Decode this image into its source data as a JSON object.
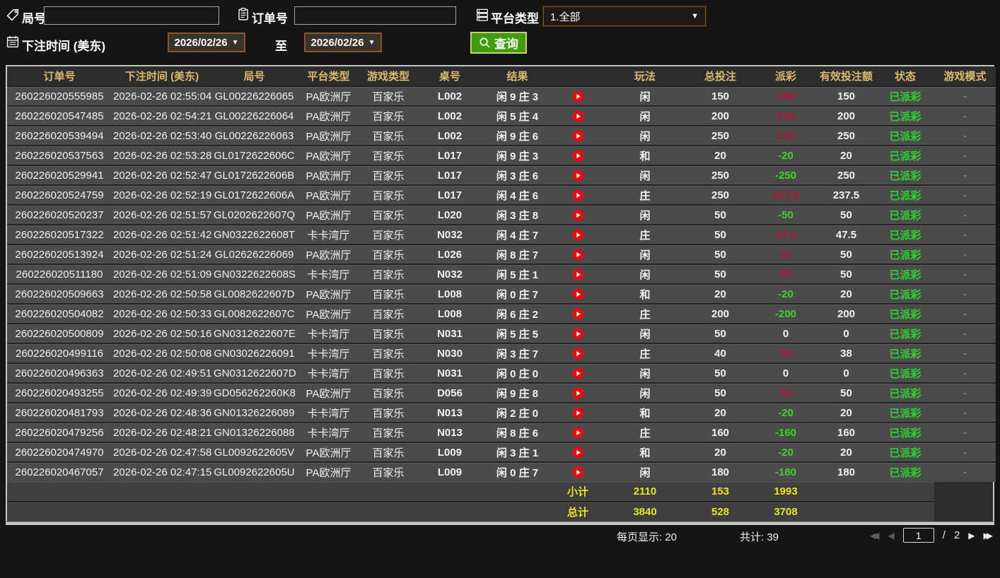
{
  "filters": {
    "round_label": "局号",
    "round_value": "",
    "order_label": "订单号",
    "order_value": "",
    "platform_label": "平台类型",
    "platform_value": "1.全部",
    "caret": "▼",
    "bet_time_label": "下注时间 (美东)",
    "date_from": "2026/02/26",
    "to_label": "至",
    "date_to": "2026/02/26",
    "query_label": "查询"
  },
  "table": {
    "headers": [
      "订单号",
      "下注时间 (美东)",
      "局号",
      "平台类型",
      "游戏类型",
      "桌号",
      "结果",
      "玩法",
      "总投注",
      "派彩",
      "有效投注额",
      "状态",
      "游戏模式"
    ],
    "column_keys": [
      "order_id",
      "bet_time",
      "round_id",
      "platform",
      "game_type",
      "table_id",
      "result",
      "play_type",
      "total_bet",
      "payout",
      "valid_bet",
      "status",
      "game_mode"
    ],
    "play_icon_name": "replay-video-icon",
    "rows": [
      [
        "260226020555985",
        "2026-02-26 02:55:04",
        "GL00226226065",
        "PA欧洲厅",
        "百家乐",
        "L002",
        "闲 9 庄 3",
        "闲",
        "150",
        "150",
        "150",
        "已派彩",
        "-"
      ],
      [
        "260226020547485",
        "2026-02-26 02:54:21",
        "GL00226226064",
        "PA欧洲厅",
        "百家乐",
        "L002",
        "闲 5 庄 4",
        "闲",
        "200",
        "200",
        "200",
        "已派彩",
        "-"
      ],
      [
        "260226020539494",
        "2026-02-26 02:53:40",
        "GL00226226063",
        "PA欧洲厅",
        "百家乐",
        "L002",
        "闲 9 庄 6",
        "闲",
        "250",
        "250",
        "250",
        "已派彩",
        "-"
      ],
      [
        "260226020537563",
        "2026-02-26 02:53:28",
        "GL0172622606C",
        "PA欧洲厅",
        "百家乐",
        "L017",
        "闲 9 庄 3",
        "和",
        "20",
        "-20",
        "20",
        "已派彩",
        "-"
      ],
      [
        "260226020529941",
        "2026-02-26 02:52:47",
        "GL0172622606B",
        "PA欧洲厅",
        "百家乐",
        "L017",
        "闲 3 庄 6",
        "闲",
        "250",
        "-250",
        "250",
        "已派彩",
        "-"
      ],
      [
        "260226020524759",
        "2026-02-26 02:52:19",
        "GL0172622606A",
        "PA欧洲厅",
        "百家乐",
        "L017",
        "闲 4 庄 6",
        "庄",
        "250",
        "237.5",
        "237.5",
        "已派彩",
        "-"
      ],
      [
        "260226020520237",
        "2026-02-26 02:51:57",
        "GL0202622607Q",
        "PA欧洲厅",
        "百家乐",
        "L020",
        "闲 3 庄 8",
        "闲",
        "50",
        "-50",
        "50",
        "已派彩",
        "-"
      ],
      [
        "260226020517322",
        "2026-02-26 02:51:42",
        "GN0322622608T",
        "卡卡湾厅",
        "百家乐",
        "N032",
        "闲 4 庄 7",
        "庄",
        "50",
        "47.5",
        "47.5",
        "已派彩",
        "-"
      ],
      [
        "260226020513924",
        "2026-02-26 02:51:24",
        "GL02626226069",
        "PA欧洲厅",
        "百家乐",
        "L026",
        "闲 8 庄 7",
        "闲",
        "50",
        "50",
        "50",
        "已派彩",
        "-"
      ],
      [
        "260226020511180",
        "2026-02-26 02:51:09",
        "GN0322622608S",
        "卡卡湾厅",
        "百家乐",
        "N032",
        "闲 5 庄 1",
        "闲",
        "50",
        "50",
        "50",
        "已派彩",
        "-"
      ],
      [
        "260226020509663",
        "2026-02-26 02:50:58",
        "GL0082622607D",
        "PA欧洲厅",
        "百家乐",
        "L008",
        "闲 0 庄 7",
        "和",
        "20",
        "-20",
        "20",
        "已派彩",
        "-"
      ],
      [
        "260226020504082",
        "2026-02-26 02:50:33",
        "GL0082622607C",
        "PA欧洲厅",
        "百家乐",
        "L008",
        "闲 6 庄 2",
        "庄",
        "200",
        "-200",
        "200",
        "已派彩",
        "-"
      ],
      [
        "260226020500809",
        "2026-02-26 02:50:16",
        "GN0312622607E",
        "卡卡湾厅",
        "百家乐",
        "N031",
        "闲 5 庄 5",
        "闲",
        "50",
        "0",
        "0",
        "已派彩",
        "-"
      ],
      [
        "260226020499116",
        "2026-02-26 02:50:08",
        "GN03026226091",
        "卡卡湾厅",
        "百家乐",
        "N030",
        "闲 3 庄 7",
        "庄",
        "40",
        "38",
        "38",
        "已派彩",
        "-"
      ],
      [
        "260226020496363",
        "2026-02-26 02:49:51",
        "GN0312622607D",
        "卡卡湾厅",
        "百家乐",
        "N031",
        "闲 0 庄 0",
        "闲",
        "50",
        "0",
        "0",
        "已派彩",
        "-"
      ],
      [
        "260226020493255",
        "2026-02-26 02:49:39",
        "GD056262260K8",
        "PA欧洲厅",
        "百家乐",
        "D056",
        "闲 9 庄 8",
        "闲",
        "50",
        "50",
        "50",
        "已派彩",
        "-"
      ],
      [
        "260226020481793",
        "2026-02-26 02:48:36",
        "GN01326226089",
        "卡卡湾厅",
        "百家乐",
        "N013",
        "闲 2 庄 0",
        "和",
        "20",
        "-20",
        "20",
        "已派彩",
        "-"
      ],
      [
        "260226020479256",
        "2026-02-26 02:48:21",
        "GN01326226088",
        "卡卡湾厅",
        "百家乐",
        "N013",
        "闲 8 庄 6",
        "庄",
        "160",
        "-160",
        "160",
        "已派彩",
        "-"
      ],
      [
        "260226020474970",
        "2026-02-26 02:47:58",
        "GL0092622605V",
        "PA欧洲厅",
        "百家乐",
        "L009",
        "闲 3 庄 1",
        "和",
        "20",
        "-20",
        "20",
        "已派彩",
        "-"
      ],
      [
        "260226020467057",
        "2026-02-26 02:47:15",
        "GL0092622605U",
        "PA欧洲厅",
        "百家乐",
        "L009",
        "闲 0 庄 7",
        "闲",
        "180",
        "-180",
        "180",
        "已派彩",
        "-"
      ]
    ],
    "subtotal": {
      "label": "小计",
      "total_bet": "2110",
      "payout": "153",
      "valid_bet": "1993"
    },
    "total": {
      "label": "总计",
      "total_bet": "3840",
      "payout": "528",
      "valid_bet": "3708"
    }
  },
  "footer": {
    "page_size_label": "每页显示: 20",
    "total_count_label": "共计: 39",
    "pagination": {
      "first_icon": "◀◀",
      "prev_icon": "◀",
      "current_page": "1",
      "separator": "/",
      "total_pages": "2",
      "next_icon": "▶",
      "last_icon": "▶▶"
    }
  },
  "colors": {
    "header_text": "#dcb96e",
    "positive_payout": "#b01535",
    "negative_payout": "#3fd42a",
    "status_paid": "#2ed32e",
    "summary_text": "#e6e71f",
    "query_button_bg": "#3e9c0e",
    "date_button_border": "#8a5420",
    "row_bg": "#4b4b4b",
    "play_icon_red": "#e01010"
  }
}
